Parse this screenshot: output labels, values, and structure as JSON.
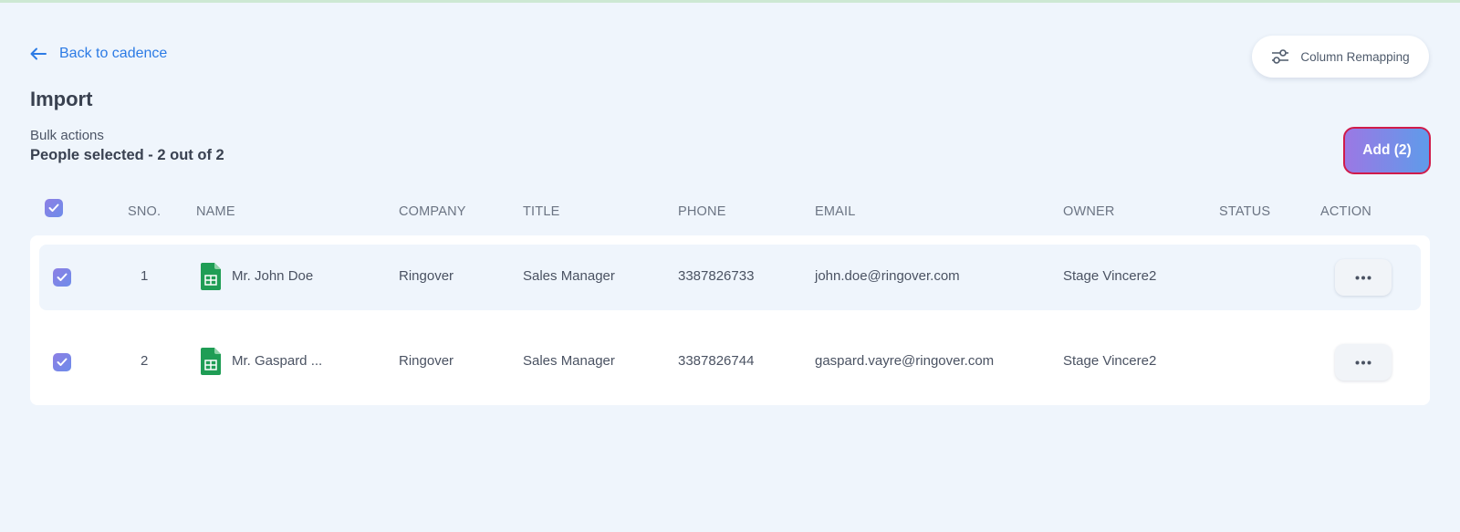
{
  "nav": {
    "back_label": "Back to cadence",
    "column_remapping_label": "Column Remapping"
  },
  "page": {
    "title": "Import",
    "bulk_actions_label": "Bulk actions",
    "people_selected": "People selected - 2 out of 2",
    "add_button_label": "Add (2)"
  },
  "table": {
    "headers": {
      "sno": "SNO.",
      "name": "NAME",
      "company": "COMPANY",
      "title": "TITLE",
      "phone": "PHONE",
      "email": "EMAIL",
      "owner": "OWNER",
      "status": "STATUS",
      "action": "ACTION"
    },
    "select_all_checked": true,
    "rows": [
      {
        "checked": true,
        "sno": "1",
        "source_icon": "google-sheets-icon",
        "name": "Mr. John Doe",
        "company": "Ringover",
        "title": "Sales Manager",
        "phone": "3387826733",
        "email": "john.doe@ringover.com",
        "owner": "Stage Vincere2",
        "status": ""
      },
      {
        "checked": true,
        "sno": "2",
        "source_icon": "google-sheets-icon",
        "name": "Mr. Gaspard ...",
        "company": "Ringover",
        "title": "Sales Manager",
        "phone": "3387826744",
        "email": "gaspard.vayre@ringover.com",
        "owner": "Stage Vincere2",
        "status": ""
      }
    ]
  },
  "colors": {
    "background": "#eff5fc",
    "link": "#2c7be5",
    "checkbox": "#7b86e6",
    "add_gradient_start": "#9b78e4",
    "add_gradient_end": "#5f9bea",
    "add_border": "#d01b4b",
    "sheets_green": "#1f9d55"
  }
}
